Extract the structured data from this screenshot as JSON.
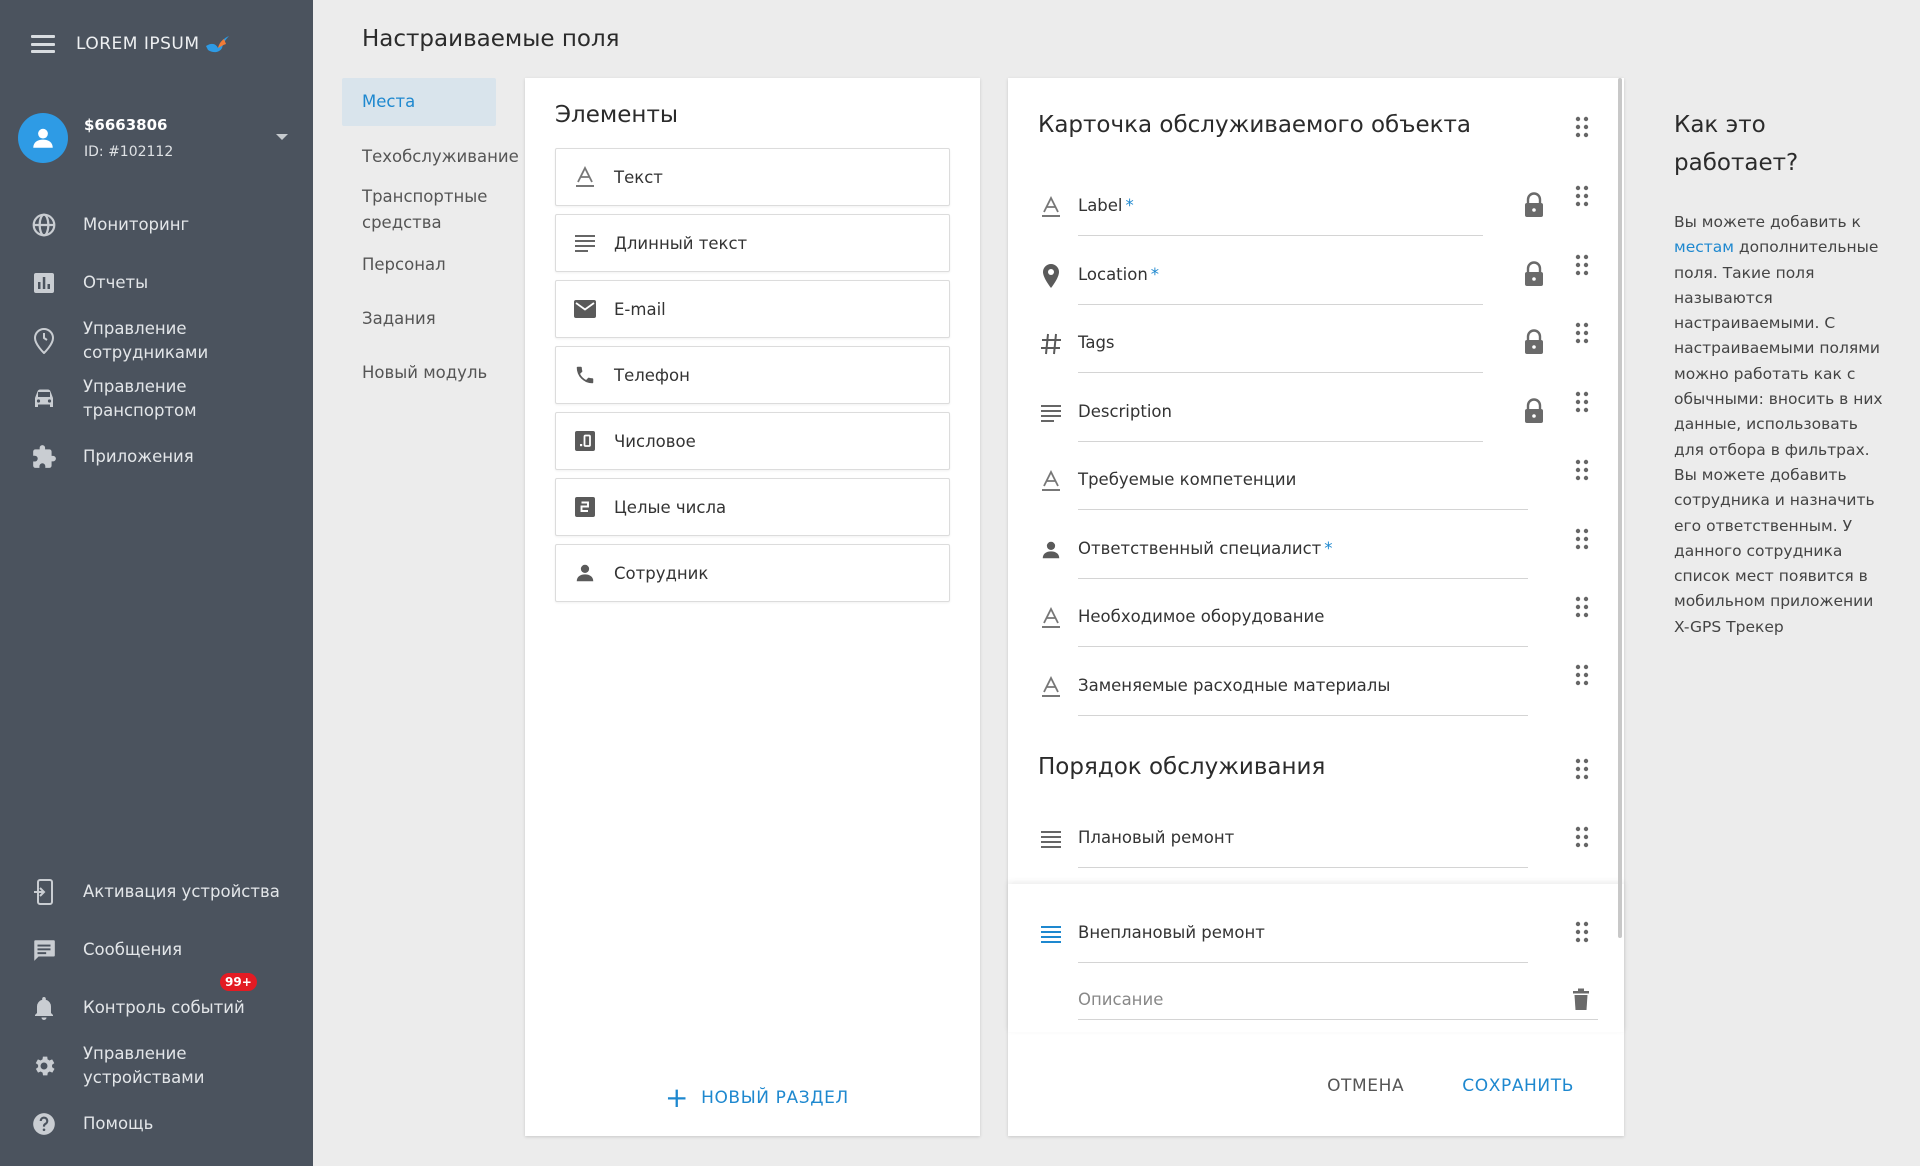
{
  "sidebar": {
    "logo_text": "LOREM IPSUM",
    "user": {
      "name": "$6663806",
      "id": "ID: #102112"
    },
    "nav_top": [
      {
        "label": "Мониторинг",
        "icon": "globe-icon"
      },
      {
        "label": "Отчеты",
        "icon": "bar-chart-icon"
      },
      {
        "label": "Управление сотрудниками",
        "icon": "location-clock-icon"
      },
      {
        "label": "Управление транспортом",
        "icon": "car-icon"
      },
      {
        "label": "Приложения",
        "icon": "puzzle-icon"
      }
    ],
    "nav_bottom": [
      {
        "label": "Активация устройства",
        "icon": "device-add-icon"
      },
      {
        "label": "Сообщения",
        "icon": "message-icon"
      },
      {
        "label": "Контроль событий",
        "icon": "bell-icon",
        "badge": "99+"
      },
      {
        "label": "Управление устройствами",
        "icon": "gear-icon"
      },
      {
        "label": "Помощь",
        "icon": "help-icon"
      }
    ]
  },
  "page": {
    "title": "Настраиваемые поля"
  },
  "subnav": [
    "Места",
    "Техобслуживание",
    "Транспортные средства",
    "Персонал",
    "Задания",
    "Новый модуль"
  ],
  "elements": {
    "title": "Элементы",
    "items": [
      {
        "label": "Текст",
        "icon": "text-icon"
      },
      {
        "label": "Длинный текст",
        "icon": "long-text-icon"
      },
      {
        "label": "E-mail",
        "icon": "email-icon"
      },
      {
        "label": "Телефон",
        "icon": "phone-icon"
      },
      {
        "label": "Числовое",
        "icon": "decimal-icon"
      },
      {
        "label": "Целые числа",
        "icon": "integer-icon"
      },
      {
        "label": "Сотрудник",
        "icon": "person-icon"
      }
    ],
    "new_section_label": "НОВЫЙ РАЗДЕЛ"
  },
  "card": {
    "section1_title": "Карточка обслуживаемого объекта",
    "fields": [
      {
        "label": "Label",
        "required": "*",
        "locked": true,
        "icon": "text-icon"
      },
      {
        "label": "Location",
        "required": "*",
        "locked": true,
        "icon": "location-pin-icon"
      },
      {
        "label": "Tags",
        "required": "",
        "locked": true,
        "icon": "hash-icon"
      },
      {
        "label": "Description",
        "required": "",
        "locked": true,
        "icon": "long-text-icon"
      },
      {
        "label": "Требуемые компетенции",
        "required": "",
        "locked": false,
        "icon": "text-icon"
      },
      {
        "label": "Ответственный специалист",
        "required": "*",
        "locked": false,
        "icon": "person-icon"
      },
      {
        "label": "Необходимое оборудование",
        "required": "",
        "locked": false,
        "icon": "text-icon"
      },
      {
        "label": "Заменяемые расходные материалы",
        "required": "",
        "locked": false,
        "icon": "text-icon"
      }
    ],
    "section2_title": "Порядок обслуживания",
    "fields2": [
      {
        "label": "Плановый ремонт",
        "icon": "long-text-icon"
      },
      {
        "label": "Внеплановый ремонт",
        "icon": "long-text-icon"
      }
    ],
    "description_placeholder": "Описание",
    "cancel_label": "ОТМЕНА",
    "save_label": "СОХРАНИТЬ"
  },
  "help": {
    "title": "Как это работает?",
    "text_before_link": "Вы можете добавить к ",
    "link_text": "местам",
    "text_after_link": " дополнительные поля. Такие поля называются настраиваемыми. С настраиваемыми полями можно работать как с обычными: вносить в них данные, использовать для отбора в фильтрах. Вы можете добавить сотрудника и назначить его ответственным. У данного сотрудника список мест появится в мобильном приложении X-GPS Трекер"
  },
  "colors": {
    "sidebar_bg": "#4b535e",
    "accent": "#1e88cf",
    "badge": "#e31b23"
  }
}
